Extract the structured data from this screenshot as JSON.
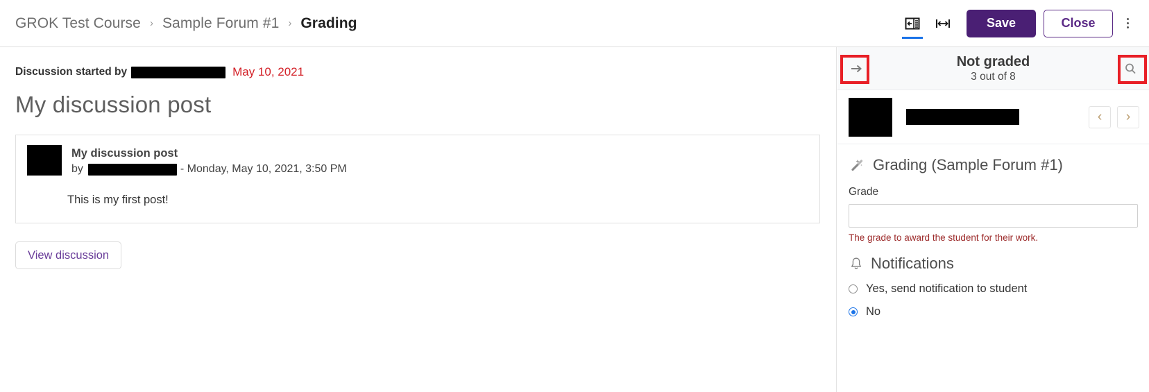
{
  "breadcrumb": {
    "items": [
      {
        "label": "GROK Test Course",
        "current": false
      },
      {
        "label": "Sample Forum #1",
        "current": false
      },
      {
        "label": "Grading",
        "current": true
      }
    ],
    "separator": "›"
  },
  "toolbar": {
    "collapse_panel_icon": "collapse-panel-icon",
    "expand_width_icon": "expand-width-icon",
    "save_label": "Save",
    "close_label": "Close",
    "more_menu_icon": "kebab-menu-icon",
    "save_bg": "#4a1f74",
    "close_fg": "#5b2a86",
    "active_tab_underline": "#1a73e8"
  },
  "main": {
    "started_label": "Discussion started by",
    "started_date": "May 10, 2021",
    "started_date_color": "#d32128",
    "discussion_title": "My discussion post",
    "post": {
      "title": "My discussion post",
      "by_prefix": "by",
      "date": "- Monday, May 10, 2021, 3:50 PM",
      "body": "This is my first post!"
    },
    "view_discussion_label": "View discussion"
  },
  "panel": {
    "header": {
      "forward_icon": "arrow-right-icon",
      "search_icon": "search-icon",
      "status_title": "Not graded",
      "status_sub": "3 out of 8",
      "annotation_color": "#e81f26"
    },
    "student": {
      "prev_icon": "‹",
      "next_icon": "›"
    },
    "grading": {
      "section_icon": "magic-wand-icon",
      "section_title": "Grading (Sample Forum #1)",
      "grade_label": "Grade",
      "grade_value": "",
      "grade_placeholder": "",
      "help_text": "The grade to award the student for their work.",
      "help_text_color": "#9c2a2a"
    },
    "notifications": {
      "section_icon": "bell-icon",
      "section_title": "Notifications",
      "options": [
        {
          "label": "Yes, send notification to student",
          "selected": false
        },
        {
          "label": "No",
          "selected": true
        }
      ]
    }
  }
}
